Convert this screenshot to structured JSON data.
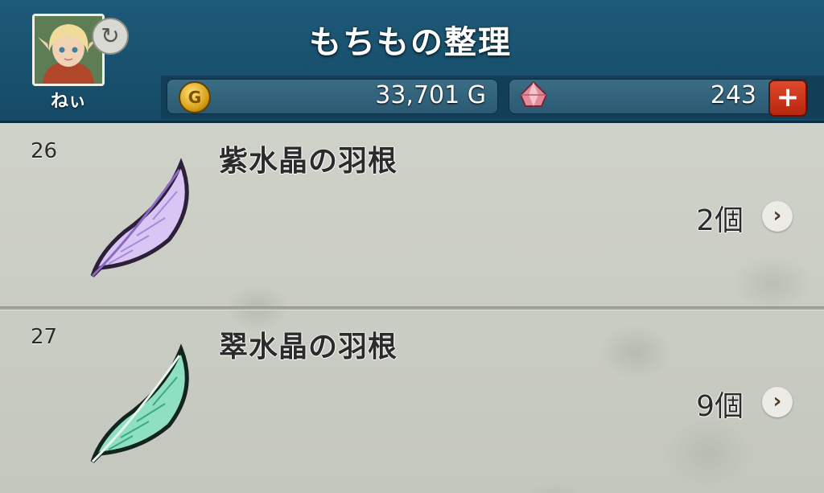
{
  "header": {
    "title": "もちもの整理",
    "player_name": "ねぃ",
    "avatar_icon": "character-portrait-icon",
    "sync_icon": "refresh-icon"
  },
  "currency": {
    "gold_icon": "gold-coin-icon",
    "gold_symbol": "G",
    "gold_amount": "33,701 G",
    "gem_icon": "gem-icon",
    "gem_amount": "243",
    "plus_label": "+"
  },
  "items": [
    {
      "number": "26",
      "name": "紫水晶の羽根",
      "quantity": "2個",
      "icon": "purple-feather-icon",
      "color": "#c7a8f0"
    },
    {
      "number": "27",
      "name": "翠水晶の羽根",
      "quantity": "9個",
      "icon": "green-feather-icon",
      "color": "#5fd0a6"
    }
  ],
  "chevron": "›",
  "colors": {
    "header_bg": "#1d5a78",
    "plus_button": "#d23a1f",
    "list_bg": "#c9ccc3"
  }
}
